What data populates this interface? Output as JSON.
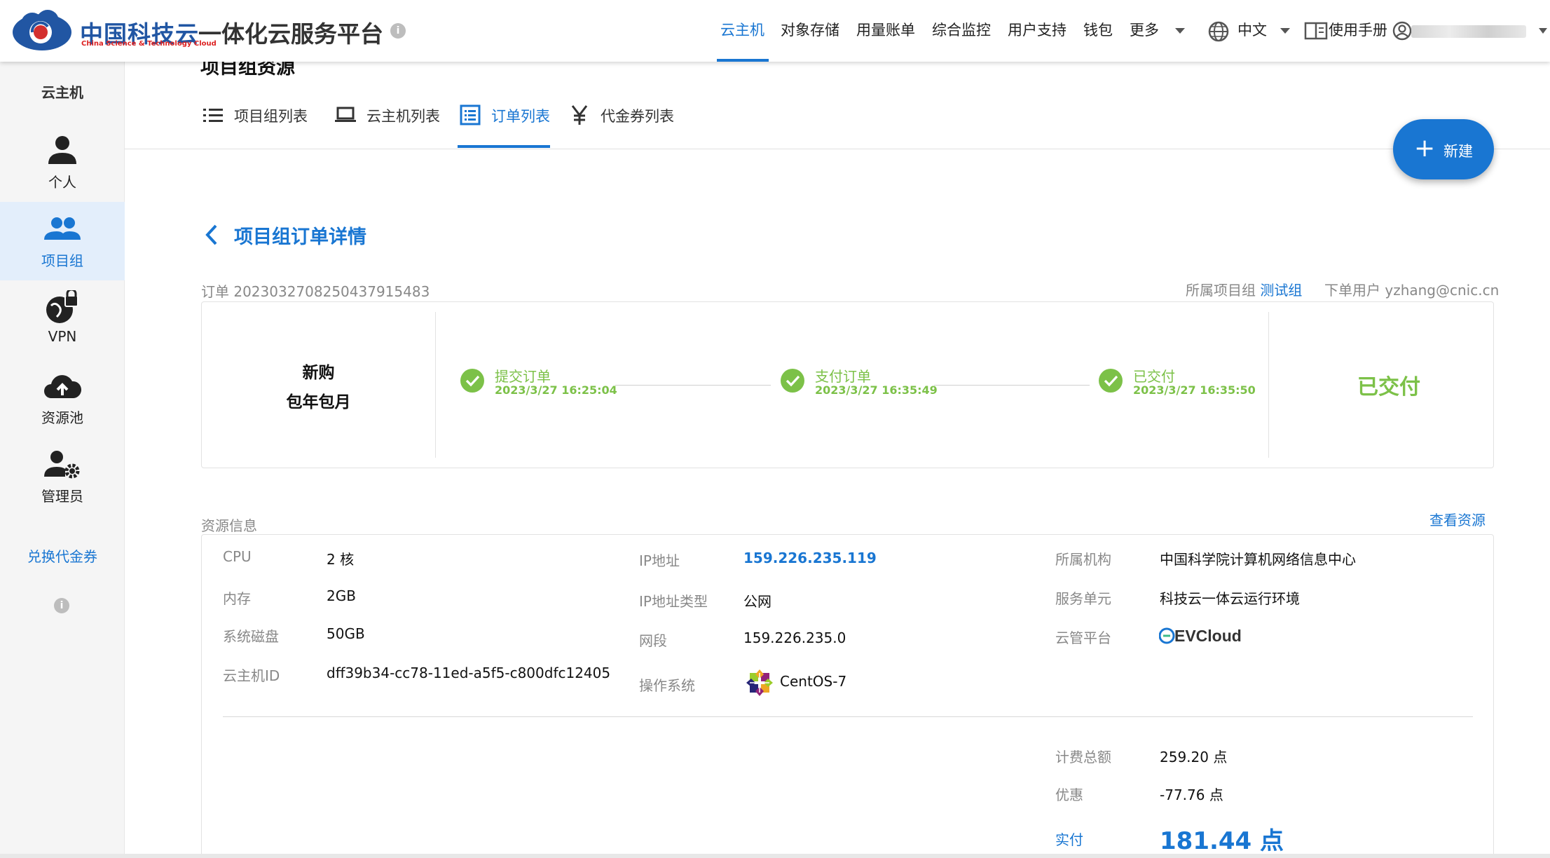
{
  "header": {
    "brand_cn": "中国科技云",
    "brand_en": "China Science & Technology Cloud",
    "title": "一体化云服务平台",
    "nav": [
      "云主机",
      "对象存储",
      "用量账单",
      "综合监控",
      "用户支持",
      "钱包",
      "更多"
    ],
    "language": "中文",
    "manual": "使用手册"
  },
  "sidebar": {
    "heading": "云主机",
    "items": [
      {
        "label": "个人",
        "icon": "person-icon"
      },
      {
        "label": "项目组",
        "icon": "group-icon"
      },
      {
        "label": "VPN",
        "icon": "vpn-globe-lock-icon"
      },
      {
        "label": "资源池",
        "icon": "cloud-upload-icon"
      },
      {
        "label": "管理员",
        "icon": "admin-gear-icon"
      }
    ],
    "voucher_link": "兑换代金券"
  },
  "main": {
    "page_title": "项目组资源",
    "tabs": [
      "项目组列表",
      "云主机列表",
      "订单列表",
      "代金券列表"
    ],
    "new_button": "新建",
    "detail_title": "项目组订单详情"
  },
  "order": {
    "number_label": "订单 2023032708250437915483",
    "project_label": "所属项目组",
    "project_name": "测试组",
    "user_label": "下单用户 yzhang@cnic.cn",
    "type_line1": "新购",
    "type_line2": "包年包月",
    "steps": [
      {
        "name": "提交订单",
        "time": "2023/3/27 16:25:04"
      },
      {
        "name": "支付订单",
        "time": "2023/3/27 16:35:49"
      },
      {
        "name": "已交付",
        "time": "2023/3/27 16:35:50"
      }
    ],
    "status": "已交付"
  },
  "resource": {
    "section_title": "资源信息",
    "view_link": "查看资源",
    "col1": [
      {
        "k": "CPU",
        "v": "2 核"
      },
      {
        "k": "内存",
        "v": "2GB"
      },
      {
        "k": "系统磁盘",
        "v": "50GB"
      },
      {
        "k": "云主机ID",
        "v": "dff39b34-cc78-11ed-a5f5-c800dfc12405"
      }
    ],
    "col2": [
      {
        "k": "IP地址",
        "v": "159.226.235.119"
      },
      {
        "k": "IP地址类型",
        "v": "公网"
      },
      {
        "k": "网段",
        "v": "159.226.235.0"
      },
      {
        "k": "操作系统",
        "v": "CentOS-7"
      }
    ],
    "col3": [
      {
        "k": "所属机构",
        "v": "中国科学院计算机网络信息中心"
      },
      {
        "k": "服务单元",
        "v": "科技云一体云运行环境"
      },
      {
        "k": "云管平台",
        "v": "EVCloud"
      }
    ],
    "billing": [
      {
        "k": "计费总额",
        "v": "259.20 点"
      },
      {
        "k": "优惠",
        "v": "-77.76 点"
      },
      {
        "k": "实付",
        "v": "181.44 点"
      }
    ]
  },
  "colors": {
    "primary": "#1976d2",
    "success": "#7cc148",
    "sidebar_bg": "#f5f5f5",
    "active_bg": "#e3eefb"
  }
}
